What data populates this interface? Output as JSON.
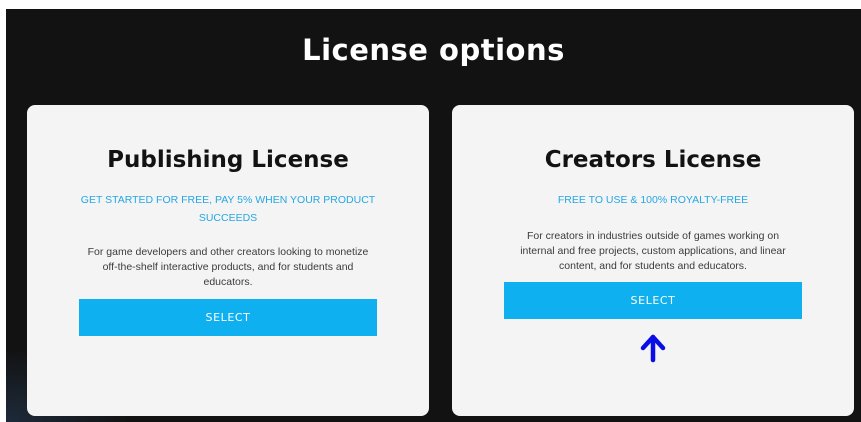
{
  "title": "License options",
  "cards": [
    {
      "title": "Publishing License",
      "tagline": "GET STARTED FOR FREE, PAY 5% WHEN YOUR PRODUCT SUCCEEDS",
      "description": "For game developers and other creators looking to monetize off-the-shelf interactive products, and for students and educators.",
      "button": "SELECT"
    },
    {
      "title": "Creators License",
      "tagline": "FREE TO USE & 100% ROYALTY-FREE",
      "description": "For creators in industries outside of games working on internal and free projects, custom applications, and linear content, and for students and educators.",
      "button": "SELECT"
    }
  ],
  "annotation": {
    "icon": "up-arrow-icon",
    "color": "#0a0ee6"
  },
  "colors": {
    "accent": "#0fb0ef",
    "tagline": "#25a7e5",
    "background": "#121212",
    "card": "#f4f4f4"
  }
}
